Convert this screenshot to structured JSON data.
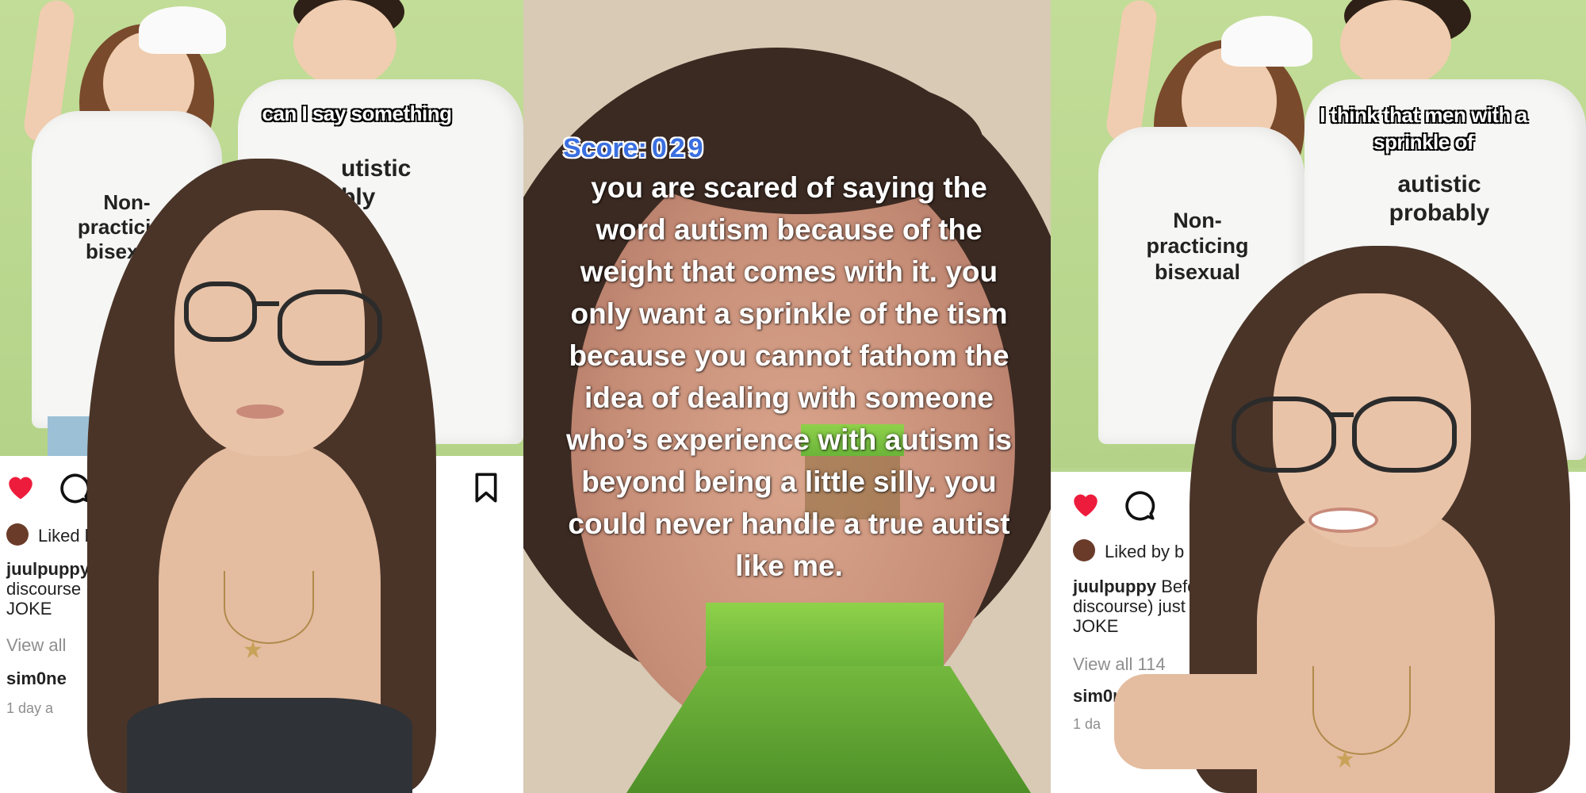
{
  "left_panel": {
    "caption": "can I say something",
    "shirt_left": "Non-\npracticing\nbisexual",
    "shirt_right": "utistic\nbly",
    "instagram": {
      "liked_by": "Liked by",
      "username": "juulpuppy",
      "line2": "discourse",
      "line3": "JOKE",
      "view_all": "View all",
      "commenter": "sim0ne",
      "time": "1 day a"
    }
  },
  "middle_panel": {
    "score_label": "Score:",
    "score_value": "029",
    "text": "you are scared of saying the word autism because of the weight that comes with it. you only want a sprinkle of the tism because you cannot fathom the idea of dealing with someone who’s experience with autism is beyond being a little silly. you could never handle a true autist like me."
  },
  "right_panel": {
    "caption": "I think that men with a sprinkle of",
    "shirt_left": "Non-\npracticing\nbisexual",
    "shirt_right": "autistic\nprobably",
    "instagram": {
      "liked_by": "Liked by b",
      "username": "juulpuppy",
      "line1_rest": "Befo",
      "line2": "discourse) just",
      "line3": "JOKE",
      "view_all": "View all 114",
      "commenter": "sim0n",
      "time": "1 da"
    }
  },
  "colors": {
    "heart": "#ed1c3c",
    "score_blue": "#3a6fe0",
    "backdrop_green": "#b8d68e"
  },
  "icons": [
    "heart-icon",
    "comment-icon",
    "share-icon",
    "bookmark-icon"
  ]
}
